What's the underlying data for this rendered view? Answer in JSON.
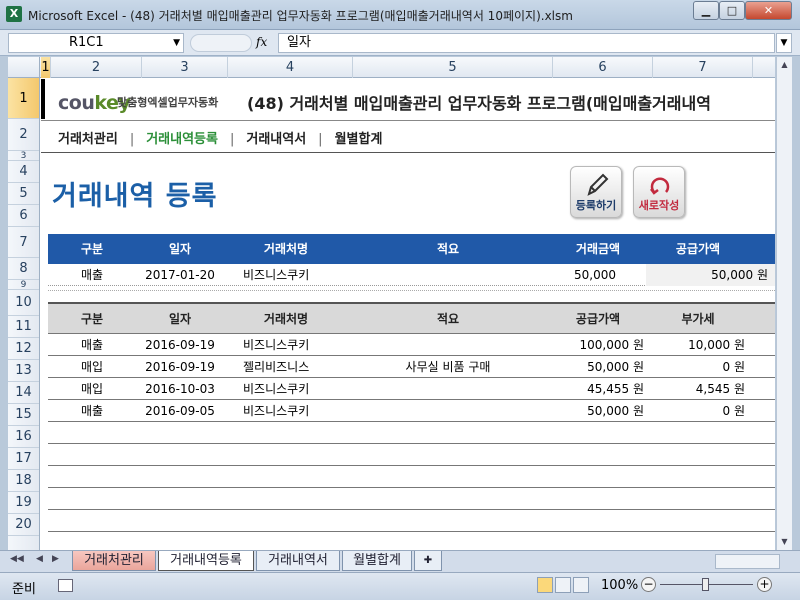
{
  "window": {
    "title": "Microsoft Excel - (48) 거래처별 매입매출관리 업무자동화 프로그램(매입매출거래내역서 10페이지).xlsm",
    "app_icon": "X"
  },
  "formula_bar": {
    "name_box": "R1C1",
    "fx": "fx",
    "value": "일자"
  },
  "columns": [
    "1",
    "2",
    "3",
    "4",
    "5",
    "6",
    "7"
  ],
  "rows": [
    "1",
    "2",
    "3",
    "4",
    "5",
    "6",
    "7",
    "8",
    "9",
    "10",
    "11",
    "12",
    "13",
    "14",
    "15",
    "16",
    "17",
    "18",
    "19",
    "20"
  ],
  "sheet": {
    "logo_brand": "cou",
    "logo_brand_key": "key",
    "logo_sub": "맞춤형엑셀업무자동화",
    "doc_title": "(48) 거래처별 매입매출관리 업무자동화 프로그램(매입매출거래내역",
    "menu": [
      "거래처관리",
      "거래내역등록",
      "거래내역서",
      "월별합계"
    ],
    "menu_sep": "|",
    "heading": "거래내역 등록",
    "register_button": "등록하기",
    "refresh_button": "새로작성"
  },
  "entry_table": {
    "headers": [
      "구분",
      "일자",
      "거래처명",
      "적요",
      "거래금액",
      "공급가액"
    ],
    "row": {
      "type": "매출",
      "date": "2017-01-20",
      "client": "비즈니스쿠키",
      "memo": "",
      "amount": "50,000",
      "supply": "50,000 원"
    }
  },
  "list_table": {
    "headers": [
      "구분",
      "일자",
      "거래처명",
      "적요",
      "공급가액",
      "부가세"
    ],
    "rows": [
      {
        "type": "매출",
        "date": "2016-09-19",
        "client": "비즈니스쿠키",
        "memo": "",
        "supply": "100,000 원",
        "vat": "10,000 원"
      },
      {
        "type": "매입",
        "date": "2016-09-19",
        "client": "젤리비즈니스",
        "memo": "사무실 비품 구매",
        "supply": "50,000 원",
        "vat": "0 원"
      },
      {
        "type": "매입",
        "date": "2016-10-03",
        "client": "비즈니스쿠키",
        "memo": "",
        "supply": "45,455 원",
        "vat": "4,545 원"
      },
      {
        "type": "매출",
        "date": "2016-09-05",
        "client": "비즈니스쿠키",
        "memo": "",
        "supply": "50,000 원",
        "vat": "0 원"
      }
    ]
  },
  "tabs": [
    "거래처관리",
    "거래내역등록",
    "거래내역서",
    "월별합계"
  ],
  "status": {
    "ready": "준비",
    "zoom": "100%"
  },
  "colors": {
    "heading_blue": "#1b5fa7",
    "header_blue": "#2059a8",
    "active_green": "#2b8f38",
    "refresh_red": "#c22a3e"
  }
}
